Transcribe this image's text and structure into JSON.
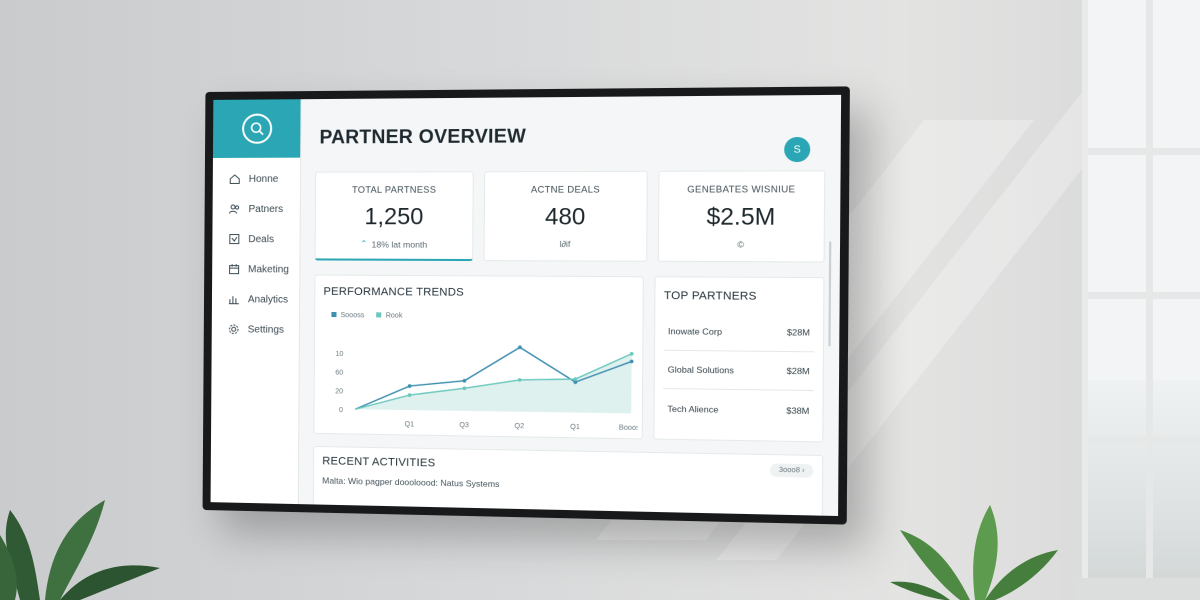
{
  "brand": {
    "accent": "#2aa6b4",
    "logo_icon": "search-icon"
  },
  "sidebar": {
    "items": [
      {
        "label": "Honne",
        "icon": "home-icon"
      },
      {
        "label": "Patners",
        "icon": "users-icon"
      },
      {
        "label": "Deals",
        "icon": "deals-icon"
      },
      {
        "label": "Maketing",
        "icon": "calendar-icon"
      },
      {
        "label": "Analytics",
        "icon": "analytics-icon"
      },
      {
        "label": "Settings",
        "icon": "gear-icon"
      }
    ]
  },
  "header": {
    "title": "PARTNER OVERVIEW",
    "avatar": "S"
  },
  "kpis": [
    {
      "label": "TOTAL PARTNESS",
      "value": "1,250",
      "sub": "18% lat month",
      "sub_icon": "arrow-up-icon"
    },
    {
      "label": "ACTNE DEALS",
      "value": "480",
      "sub": "l∂if"
    },
    {
      "label": "GENEBATES WISNIUE",
      "value": "$2.5M",
      "sub": "©"
    }
  ],
  "trends": {
    "title": "PERFORMANCE TRENDS",
    "legend": [
      "Soooss",
      "Rook"
    ]
  },
  "chart_data": {
    "type": "line",
    "categories": [
      "",
      "Q1",
      "Q3",
      "Q2",
      "Q1",
      "Boooss"
    ],
    "yticks": [
      "0",
      "20",
      "60",
      "10"
    ],
    "series": [
      {
        "name": "Soooss",
        "values": [
          0,
          32,
          40,
          85,
          40,
          68
        ]
      },
      {
        "name": "Rook",
        "values": [
          0,
          20,
          30,
          42,
          44,
          78
        ]
      }
    ],
    "colors": [
      "#3f8fb0",
      "#6cc8bf"
    ]
  },
  "top_partners": {
    "title": "TOP PARTNERS",
    "rows": [
      {
        "name": "Inowate Corp",
        "value": "$28M"
      },
      {
        "name": "Global Solutions",
        "value": "$28M"
      },
      {
        "name": "Tech Alience",
        "value": "$38M"
      }
    ]
  },
  "recent": {
    "title": "RECENT ACTIVITIES",
    "more_label": "3ooo8",
    "line": "Malta: Wio pagper doooloood: Natus Systems"
  }
}
